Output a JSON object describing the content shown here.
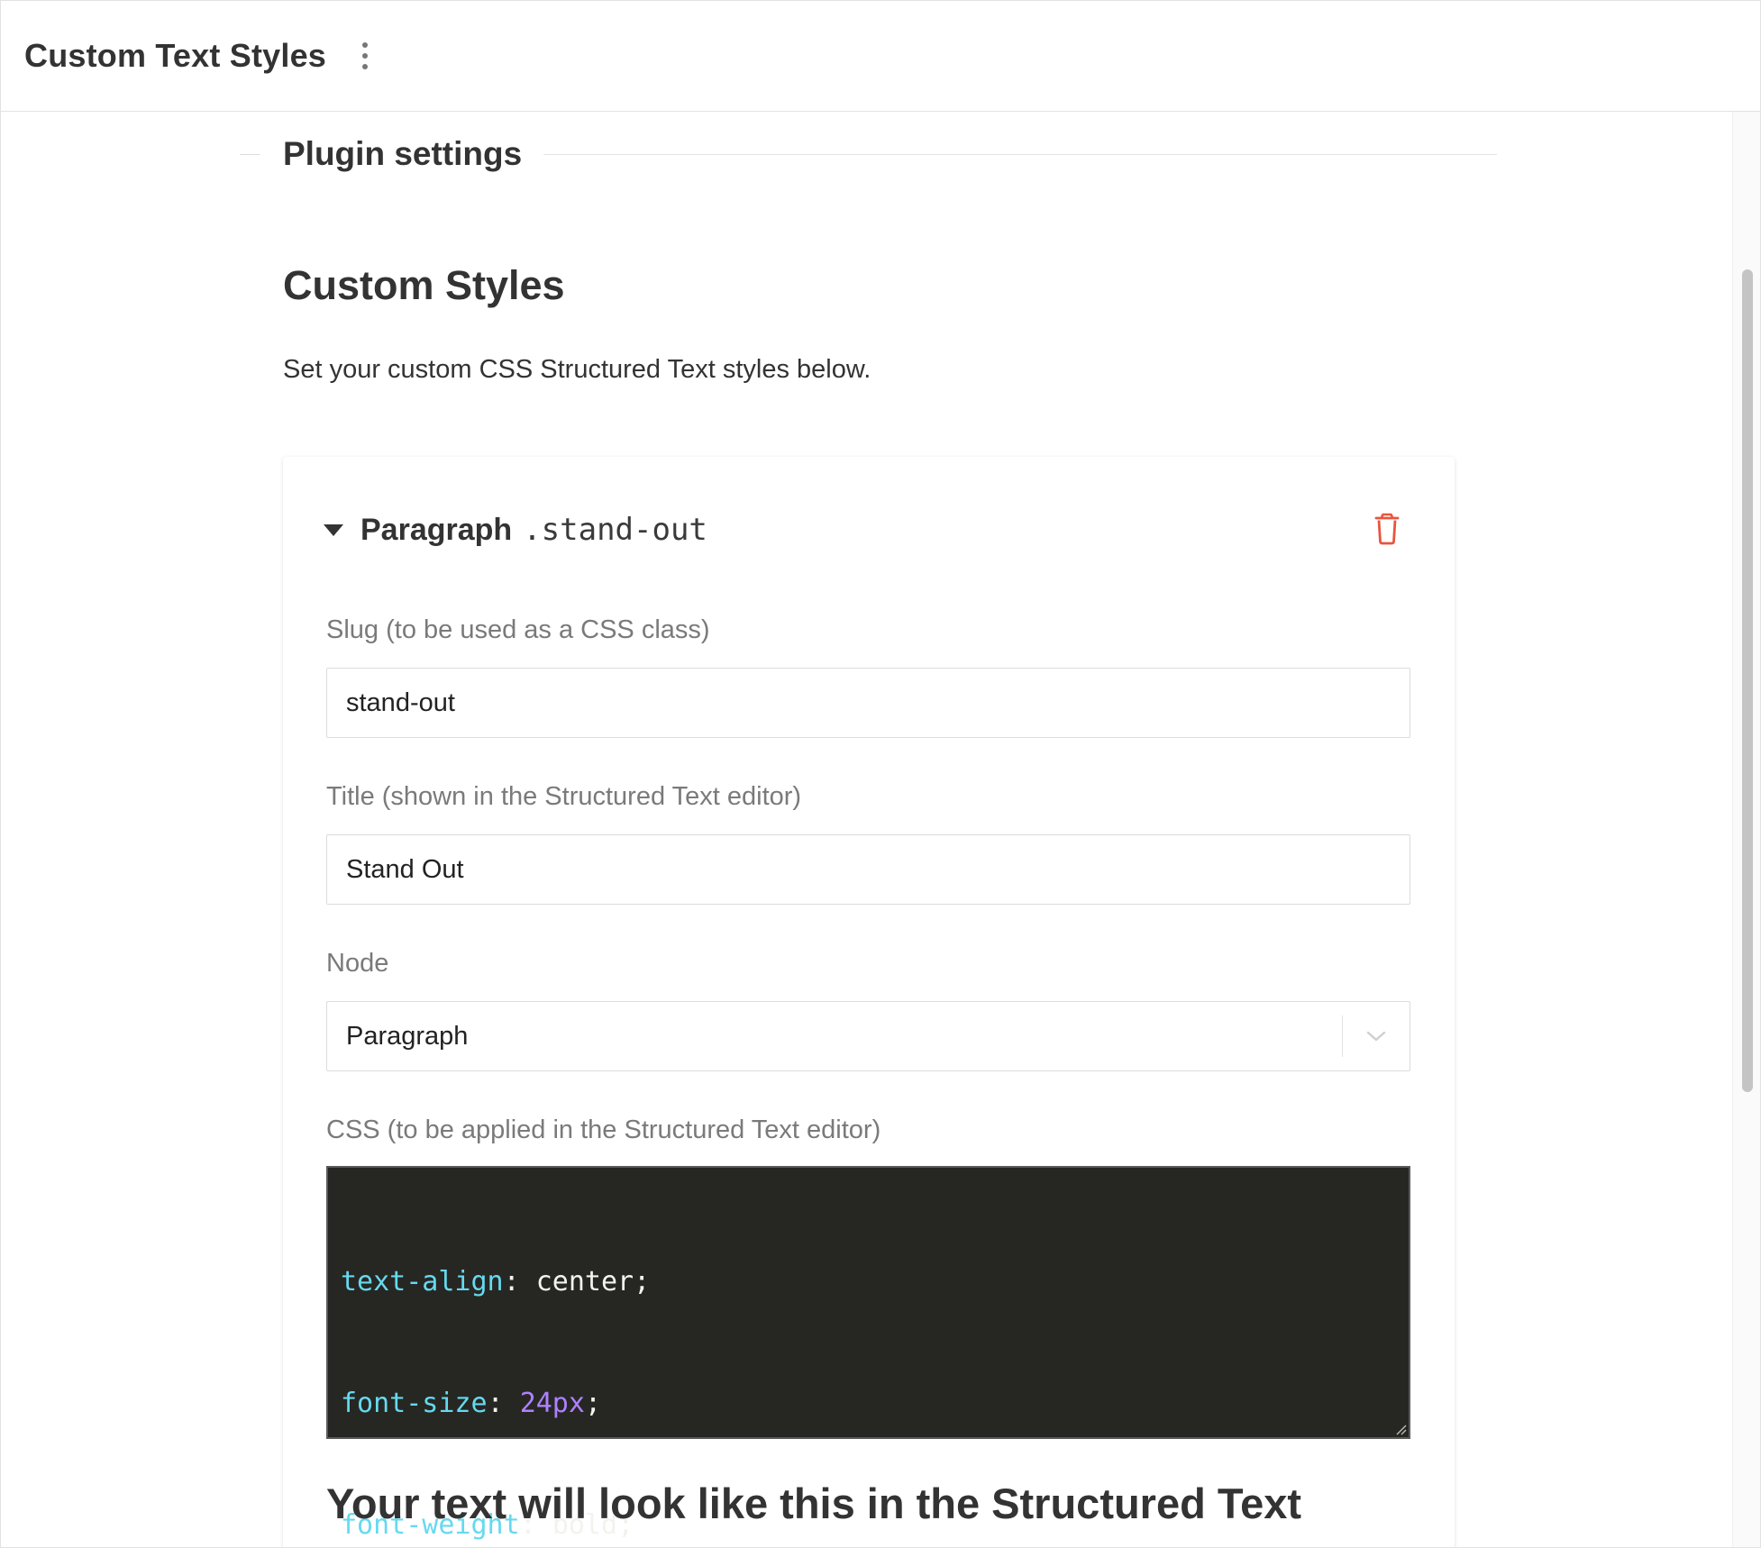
{
  "header": {
    "app_title": "Custom Text Styles"
  },
  "section": {
    "title": "Plugin settings"
  },
  "main": {
    "heading": "Custom Styles",
    "intro": "Set your custom CSS Structured Text styles below."
  },
  "style_card": {
    "node_name": "Paragraph",
    "slug_display": ".stand-out",
    "fields": {
      "slug": {
        "label": "Slug (to be used as a CSS class)",
        "value": "stand-out"
      },
      "title": {
        "label": "Title (shown in the Structured Text editor)",
        "value": "Stand Out"
      },
      "node": {
        "label": "Node",
        "selected": "Paragraph"
      },
      "css": {
        "label": "CSS (to be applied in the Structured Text editor)",
        "lines": [
          {
            "property": "text-align",
            "value": "center"
          },
          {
            "property": "font-size",
            "value": "24px"
          },
          {
            "property": "font-weight",
            "value": "bold"
          }
        ]
      }
    },
    "preview_heading": "Your text will look like this in the Structured Text"
  },
  "icons": {
    "menu": "kebab-menu-icon",
    "expand": "caret-down-icon",
    "delete": "trash-icon",
    "dropdown": "chevron-down-icon"
  },
  "colors": {
    "delete_icon": "#e8553e",
    "editor_bg": "#262723",
    "css_property": "#66d9ef",
    "css_number": "#ae81ff",
    "scrollbar_thumb": "#c4c4c4"
  }
}
